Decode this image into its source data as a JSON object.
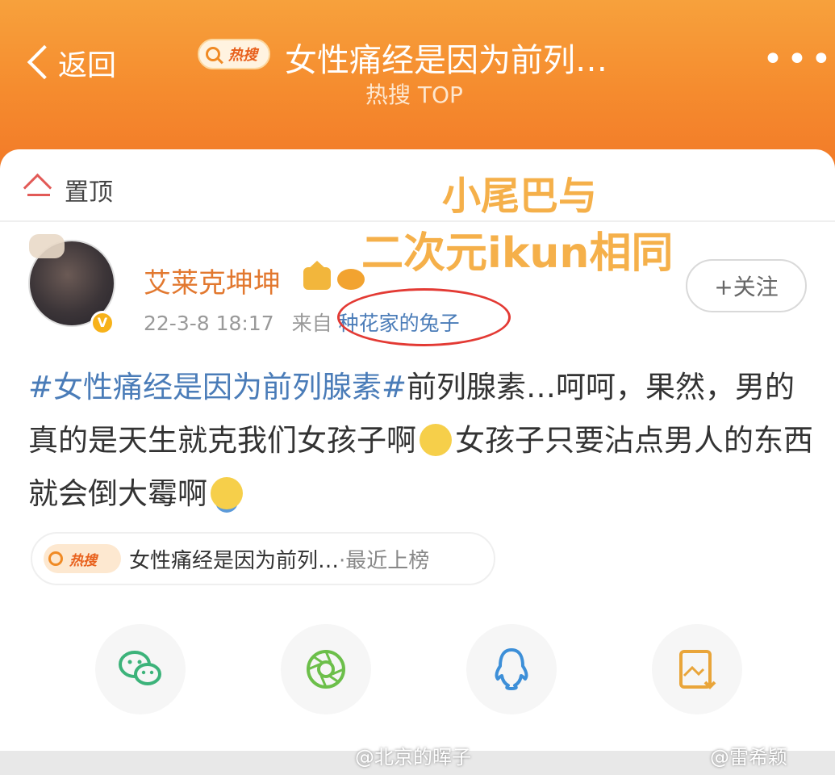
{
  "header": {
    "back_label": "返回",
    "hot_badge": "热搜",
    "title": "女性痛经是因为前列…",
    "subtitle": "热搜 TOP",
    "more_label": "•••"
  },
  "pinned": {
    "label": "置顶"
  },
  "overlay": {
    "line1": "小尾巴与",
    "line2": "二次元ikun相同"
  },
  "post": {
    "username": "艾莱克坤坤",
    "verified": "V",
    "date": "22-3-8 18:17",
    "source_prefix": "来自",
    "source": "种花家的兔子",
    "follow_label": "+关注",
    "hashtag": "#女性痛经是因为前列腺素#",
    "text1": "前列腺素…呵呵，果然，男的真的是天生就克我们女孩子啊",
    "text2": "女孩子只要沾点男人的东西就会倒大霉啊"
  },
  "topic": {
    "badge": "热搜",
    "title": "女性痛经是因为前列…",
    "suffix": "·最近上榜"
  },
  "share": [
    "wechat-icon",
    "moments-icon",
    "qq-icon",
    "save-image-icon"
  ],
  "watermarks": {
    "left": "@北京的晖子",
    "right": "@雷希颖"
  },
  "colors": {
    "header_orange": "#f58b2e",
    "link_blue": "#4a7cb8",
    "username_orange": "#e2782f",
    "overlay_yellow": "#f5b04a",
    "circle_red": "#e33a34"
  }
}
